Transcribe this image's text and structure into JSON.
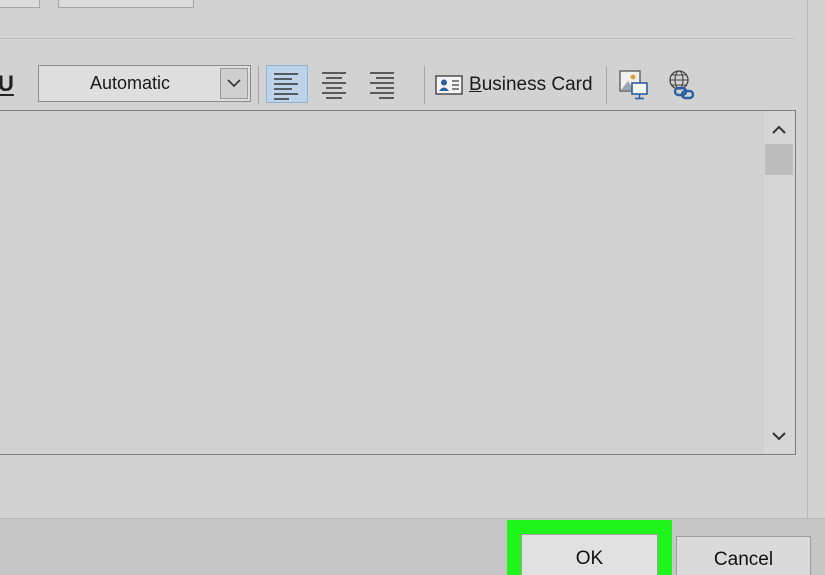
{
  "toolbar": {
    "underline_label": "U",
    "color_select": {
      "value": "Automatic"
    },
    "alignment": {
      "active": "left"
    },
    "business_card": {
      "label_prefix": "B",
      "label_rest": "usiness Card"
    }
  },
  "editor": {
    "content": ""
  },
  "footer": {
    "ok_label": "OK",
    "cancel_label": "Cancel",
    "highlight_color": "#1ff51a"
  },
  "icons": {
    "dropdown": "chevron-down-icon",
    "align_left": "align-left-icon",
    "align_center": "align-center-icon",
    "align_right": "align-right-icon",
    "business_card": "business-card-icon",
    "picture": "insert-picture-icon",
    "hyperlink": "hyperlink-icon",
    "scroll_up": "chevron-up-icon",
    "scroll_down": "chevron-down-icon"
  }
}
